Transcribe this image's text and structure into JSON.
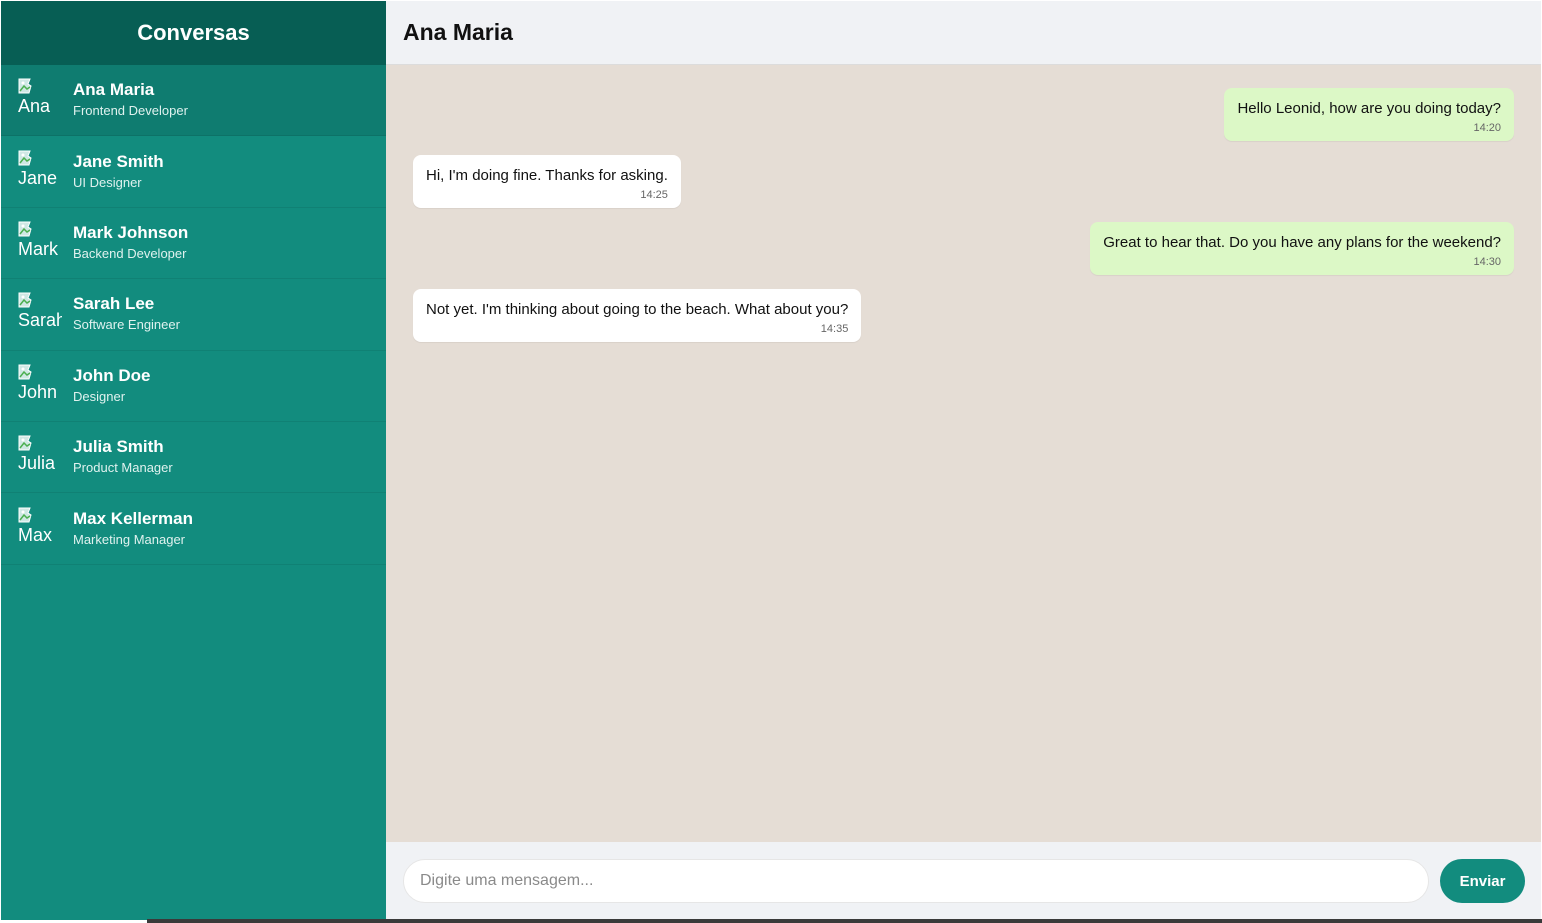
{
  "sidebar": {
    "title": "Conversas",
    "contacts": [
      {
        "name": "Ana Maria",
        "role": "Frontend Developer",
        "avatar_alt": "Ana",
        "active": true
      },
      {
        "name": "Jane Smith",
        "role": "UI Designer",
        "avatar_alt": "Jane"
      },
      {
        "name": "Mark Johnson",
        "role": "Backend Developer",
        "avatar_alt": "Mark"
      },
      {
        "name": "Sarah Lee",
        "role": "Software Engineer",
        "avatar_alt": "Sarah"
      },
      {
        "name": "John Doe",
        "role": "Designer",
        "avatar_alt": "John"
      },
      {
        "name": "Julia Smith",
        "role": "Product Manager",
        "avatar_alt": "Julia"
      },
      {
        "name": "Max Kellerman",
        "role": "Marketing Manager",
        "avatar_alt": "Max"
      }
    ]
  },
  "chat": {
    "contact_name": "Ana Maria",
    "messages": [
      {
        "text": "Hello Leonid, how are you doing today?",
        "time": "14:20",
        "direction": "sent"
      },
      {
        "text": "Hi, I'm doing fine. Thanks for asking.",
        "time": "14:25",
        "direction": "received"
      },
      {
        "text": "Great to hear that. Do you have any plans for the weekend?",
        "time": "14:30",
        "direction": "sent"
      },
      {
        "text": "Not yet. I'm thinking about going to the beach. What about you?",
        "time": "14:35",
        "direction": "received"
      }
    ]
  },
  "composer": {
    "placeholder": "Digite uma mensagem...",
    "value": "",
    "send_label": "Enviar"
  },
  "colors": {
    "sidebar_bg": "#128c7e",
    "sidebar_header_bg": "#075e54",
    "active_item_bg": "#0f7c70",
    "chat_bg": "#e5ddd5",
    "sent_bubble": "#dcf8c6",
    "received_bubble": "#ffffff"
  },
  "icons": {
    "avatar": "broken-image-icon"
  }
}
